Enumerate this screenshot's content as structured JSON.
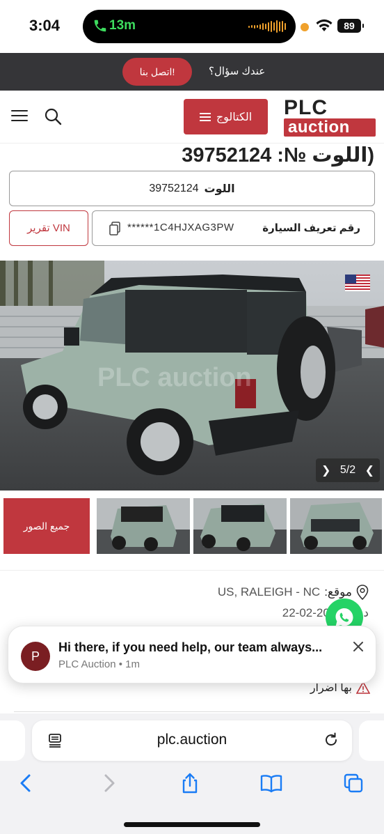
{
  "status_bar": {
    "time": "3:04",
    "call_duration": "13m",
    "battery": "89"
  },
  "contact_bar": {
    "question": "عندك سؤال؟",
    "contact_button": "اتصل بنا!"
  },
  "header": {
    "catalog_label": "الكتالوج",
    "logo_top": "PLC",
    "logo_bottom": "auction"
  },
  "lot": {
    "title": "(اللوت №: 39752124",
    "lot_label": "اللوت",
    "lot_number": "39752124",
    "vin_report_label": "تقرير VIN",
    "vin_label": "رقم تعريف السيارة",
    "vin_value": "******1C4HJXAG3PW"
  },
  "gallery": {
    "counter": "5/2",
    "all_photos_label": "جميع الصور",
    "watermark": "PLC auction"
  },
  "details": {
    "location_label": "موقع:",
    "location_value": "US, RALEIGH - NC",
    "date_label": "ديثة:",
    "date_value": "22-02-2024",
    "damage_label": "بها أضرار"
  },
  "notification": {
    "avatar_letter": "P",
    "message": "Hi there, if you need help, our team always...",
    "source": "PLC Auction • 1m"
  },
  "browser": {
    "url": "plc.auction"
  },
  "colors": {
    "brand_red": "#c0373e",
    "dark_bar": "#353538",
    "whatsapp_green": "#25d366",
    "ios_blue": "#1a7cf5"
  }
}
